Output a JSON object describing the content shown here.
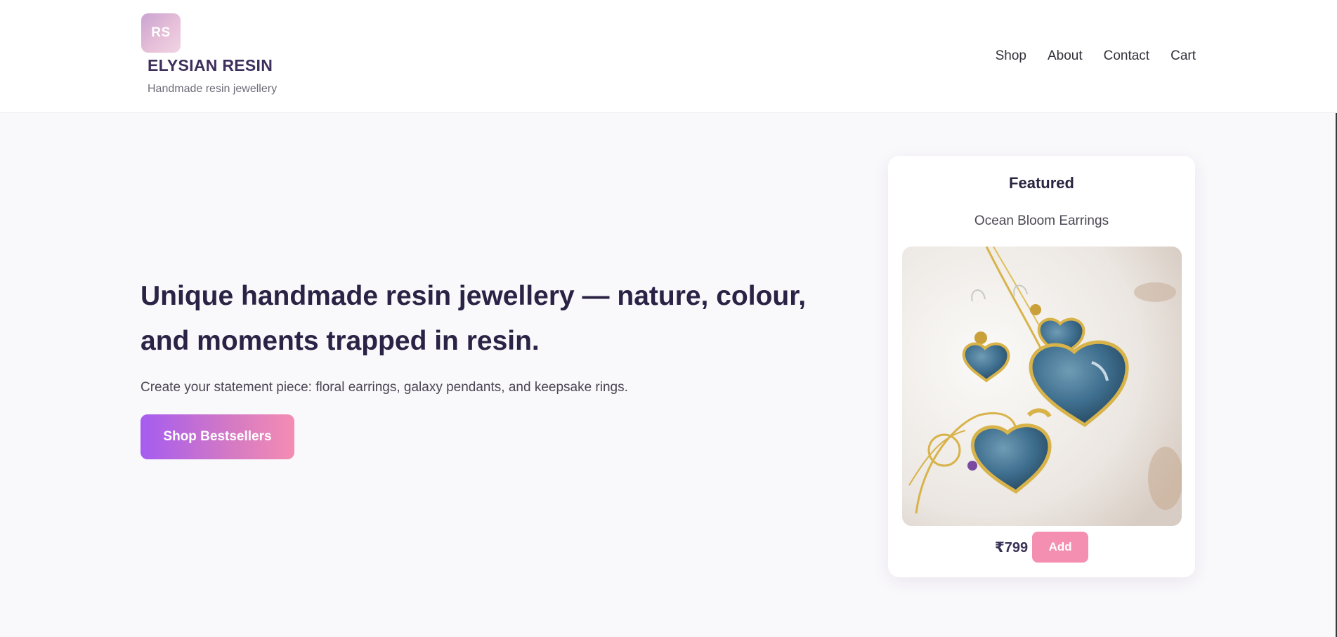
{
  "brand": {
    "badge": "RS",
    "name": "ELYSIAN RESIN",
    "tagline": "Handmade resin jewellery"
  },
  "nav": {
    "items": [
      "Shop",
      "About",
      "Contact",
      "Cart"
    ]
  },
  "hero": {
    "title": "Unique handmade resin jewellery — nature, colour, and moments trapped in resin.",
    "subtitle": "Create your statement piece: floral earrings, galaxy pendants, and keepsake rings.",
    "cta_label": "Shop Bestsellers"
  },
  "featured": {
    "heading": "Featured",
    "product_name": "Ocean Bloom Earrings",
    "image_icon": "blue-resin-heart-jewellery-photo",
    "price": "₹799",
    "add_label": "Add"
  },
  "colors": {
    "brand_purple": "#3d2f5c",
    "cta_start": "#a55cf0",
    "cta_end": "#f58db3",
    "add_button": "#f48fb1",
    "page_bg": "#f9f8fb"
  }
}
